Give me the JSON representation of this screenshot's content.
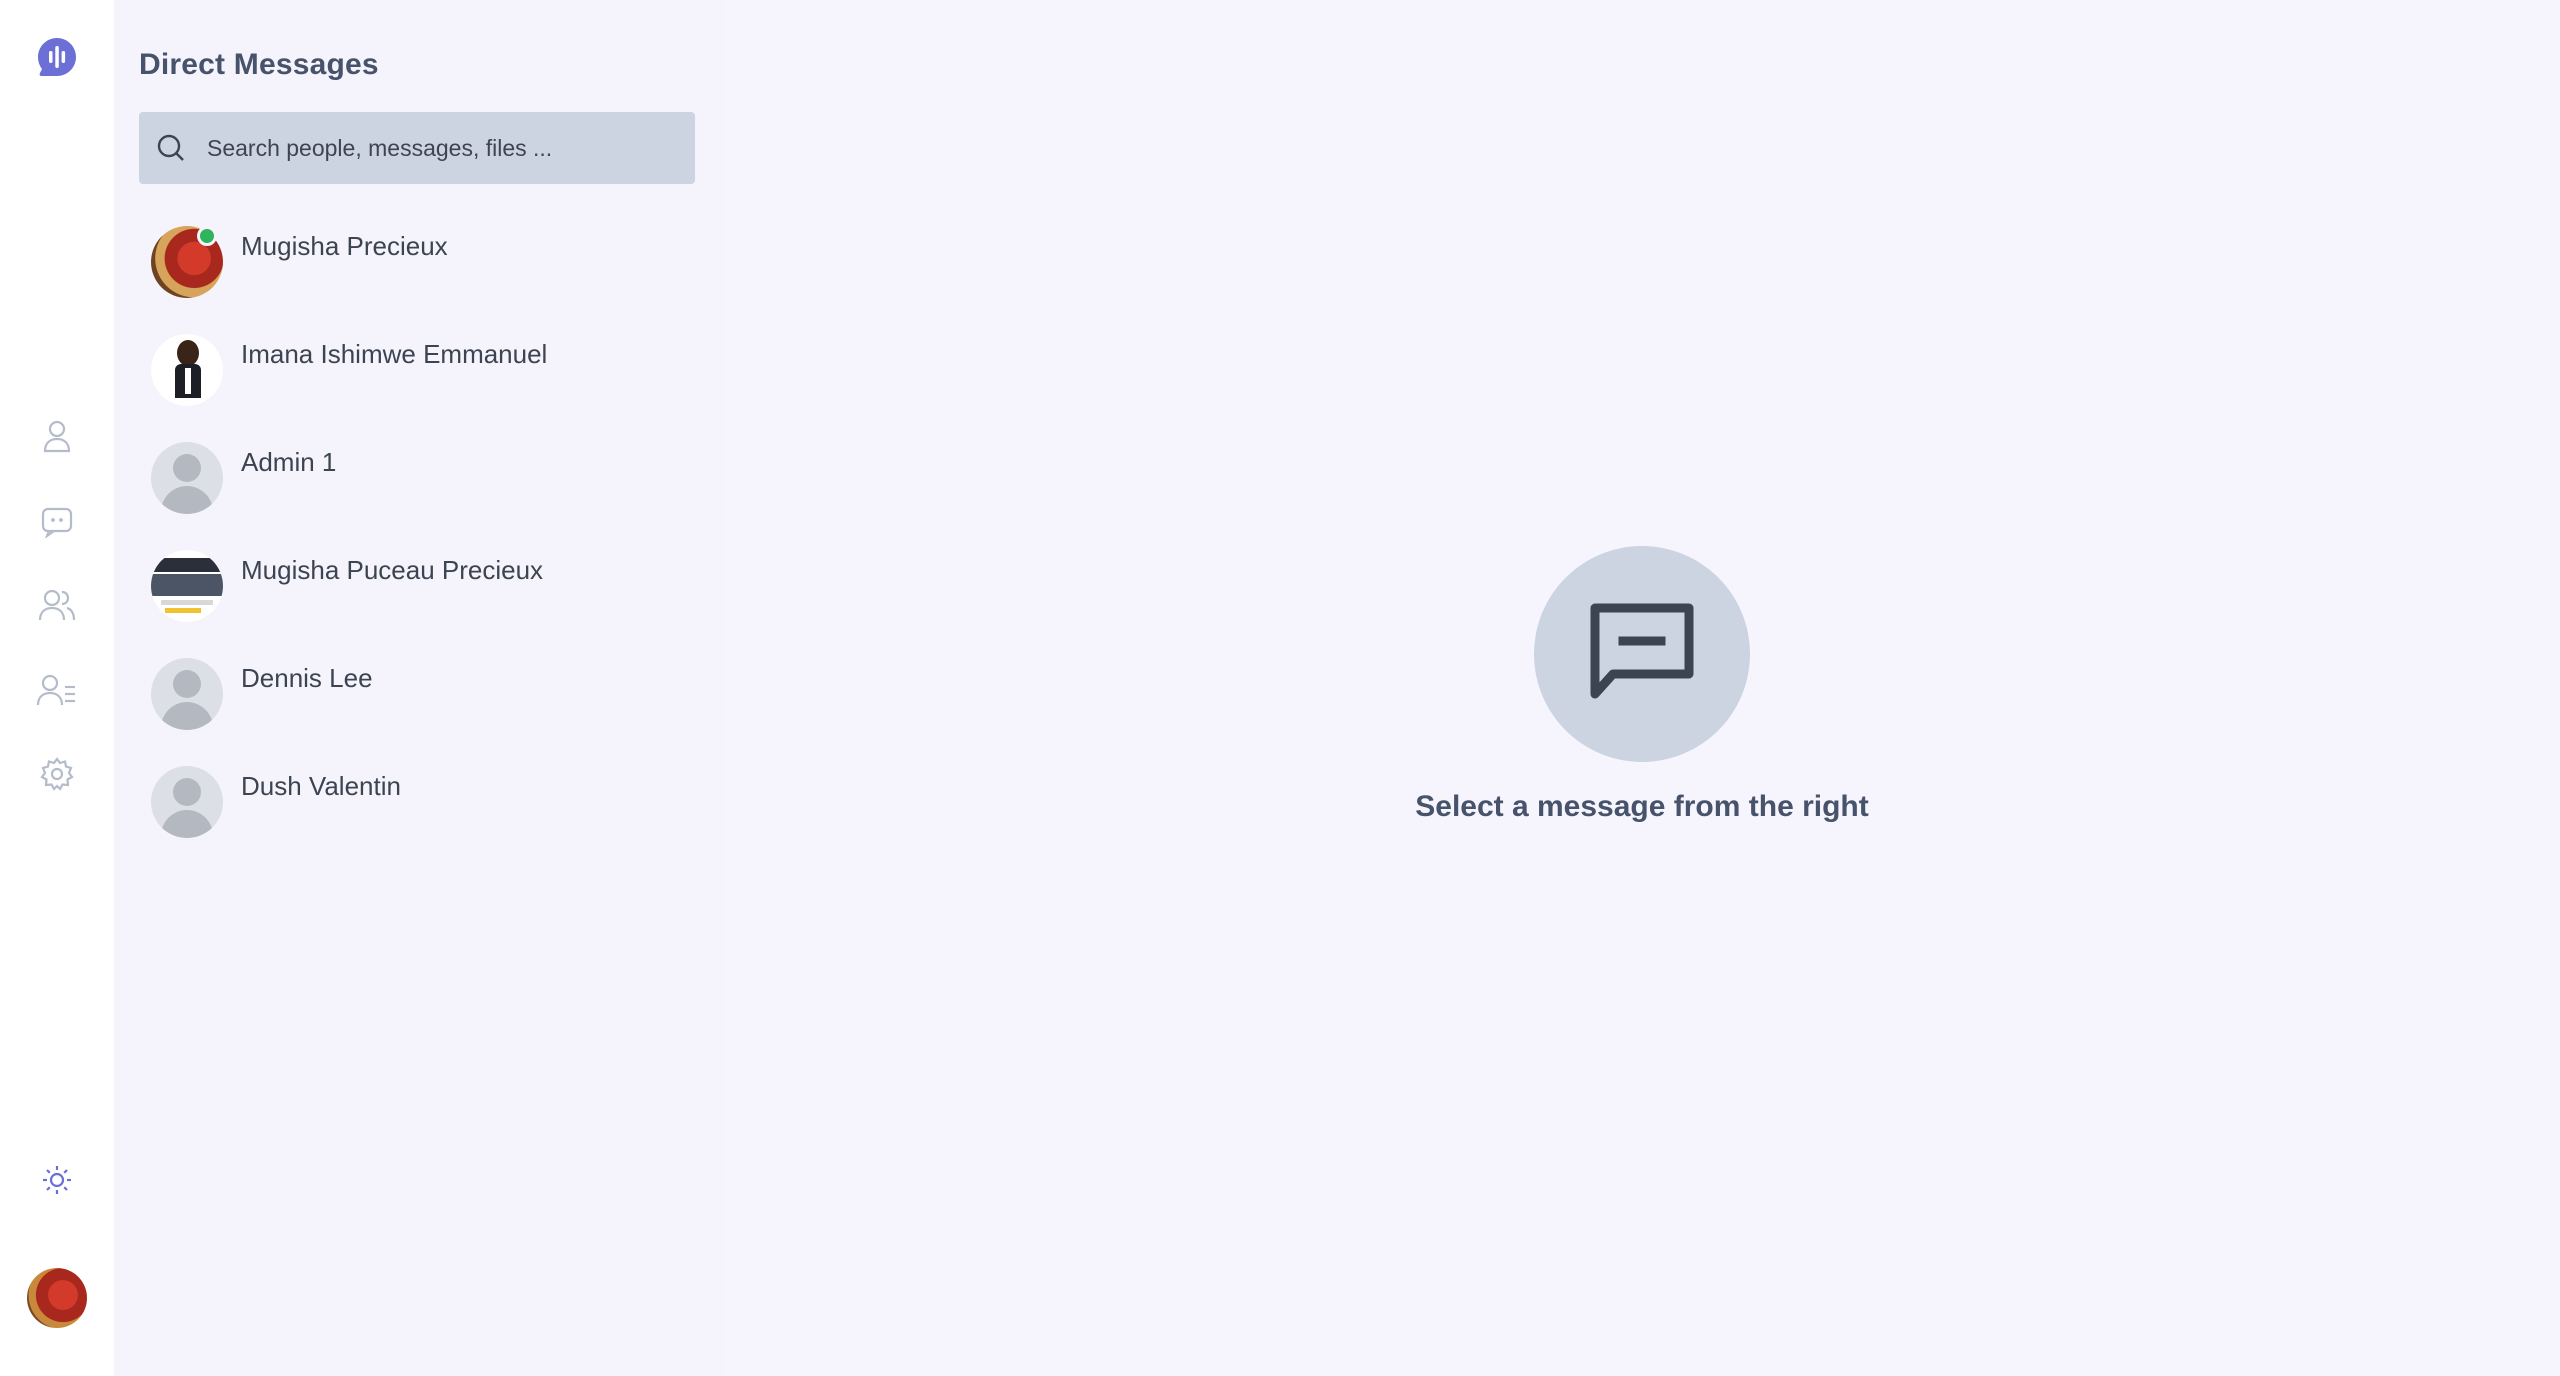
{
  "rail": {
    "logo_icon": "audio-bars-icon",
    "nav": [
      {
        "icon": "user-icon",
        "name": "profile"
      },
      {
        "icon": "chat-bubble-icon",
        "name": "chats"
      },
      {
        "icon": "users-icon",
        "name": "groups"
      },
      {
        "icon": "contacts-list-icon",
        "name": "contacts"
      },
      {
        "icon": "gear-icon",
        "name": "settings"
      }
    ],
    "theme_icon": "sun-icon",
    "accent_color": "#6c6fd6"
  },
  "dm_panel": {
    "title": "Direct Messages",
    "search_placeholder": "Search people, messages, files ...",
    "contacts": [
      {
        "name": "Mugisha Precieux",
        "online": true
      },
      {
        "name": "Imana Ishimwe Emmanuel",
        "online": false
      },
      {
        "name": "Admin 1",
        "online": false
      },
      {
        "name": "Mugisha Puceau Precieux",
        "online": false
      },
      {
        "name": "Dennis Lee",
        "online": false
      },
      {
        "name": "Dush Valentin",
        "online": false
      }
    ]
  },
  "main": {
    "empty_icon": "message-square-icon",
    "empty_text": "Select a message from the right"
  },
  "colors": {
    "online": "#2fb35b",
    "search_bg": "#ccd4e1",
    "panel_bg": "#f5f4fc"
  }
}
